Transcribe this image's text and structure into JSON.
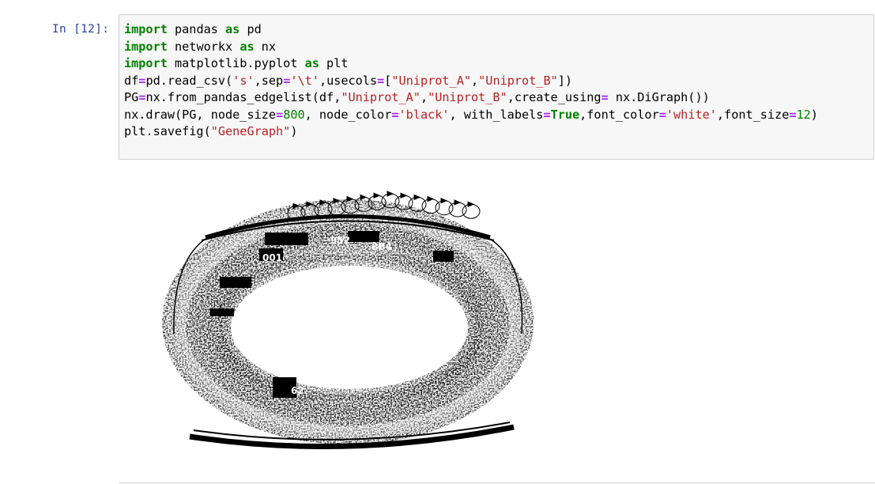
{
  "cell": {
    "prompt": "In [12]:",
    "lines": [
      [
        {
          "t": "import",
          "c": "kw"
        },
        {
          "t": " pandas ",
          "c": ""
        },
        {
          "t": "as",
          "c": "kw"
        },
        {
          "t": " pd",
          "c": ""
        }
      ],
      [
        {
          "t": "import",
          "c": "kw"
        },
        {
          "t": " networkx ",
          "c": ""
        },
        {
          "t": "as",
          "c": "kw"
        },
        {
          "t": " nx",
          "c": ""
        }
      ],
      [
        {
          "t": "import",
          "c": "kw"
        },
        {
          "t": " matplotlib.pyplot ",
          "c": ""
        },
        {
          "t": "as",
          "c": "kw"
        },
        {
          "t": " plt",
          "c": ""
        }
      ],
      [
        {
          "t": "df",
          "c": ""
        },
        {
          "t": "=",
          "c": "op"
        },
        {
          "t": "pd.read_csv(",
          "c": ""
        },
        {
          "t": "'s'",
          "c": "str"
        },
        {
          "t": ",sep",
          "c": ""
        },
        {
          "t": "=",
          "c": "op"
        },
        {
          "t": "'\\t'",
          "c": "str"
        },
        {
          "t": ",usecols",
          "c": ""
        },
        {
          "t": "=",
          "c": "op"
        },
        {
          "t": "[",
          "c": ""
        },
        {
          "t": "\"Uniprot_A\"",
          "c": "str"
        },
        {
          "t": ",",
          "c": ""
        },
        {
          "t": "\"Uniprot_B\"",
          "c": "str"
        },
        {
          "t": "])",
          "c": ""
        }
      ],
      [
        {
          "t": "PG",
          "c": ""
        },
        {
          "t": "=",
          "c": "op"
        },
        {
          "t": "nx.from_pandas_edgelist(df,",
          "c": ""
        },
        {
          "t": "\"Uniprot_A\"",
          "c": "str"
        },
        {
          "t": ",",
          "c": ""
        },
        {
          "t": "\"Uniprot_B\"",
          "c": "str"
        },
        {
          "t": ",create_using",
          "c": ""
        },
        {
          "t": "=",
          "c": "op"
        },
        {
          "t": " nx.DiGraph())",
          "c": ""
        }
      ],
      [
        {
          "t": "nx.draw(PG, node_size",
          "c": ""
        },
        {
          "t": "=",
          "c": "op"
        },
        {
          "t": "800",
          "c": "num"
        },
        {
          "t": ", node_color",
          "c": ""
        },
        {
          "t": "=",
          "c": "op"
        },
        {
          "t": "'black'",
          "c": "str"
        },
        {
          "t": ", with_labels",
          "c": ""
        },
        {
          "t": "=",
          "c": "op"
        },
        {
          "t": "True",
          "c": "kw"
        },
        {
          "t": ",font_color",
          "c": ""
        },
        {
          "t": "=",
          "c": "op"
        },
        {
          "t": "'white'",
          "c": "str"
        },
        {
          "t": ",font_size",
          "c": ""
        },
        {
          "t": "=",
          "c": "op"
        },
        {
          "t": "12",
          "c": "num"
        },
        {
          "t": ")",
          "c": ""
        }
      ],
      [
        {
          "t": "plt.savefig(",
          "c": ""
        },
        {
          "t": "\"GeneGraph\"",
          "c": "str"
        },
        {
          "t": ")",
          "c": ""
        }
      ]
    ]
  },
  "output": {
    "node_labels": [
      "952",
      "8B4",
      "001",
      "62"
    ]
  }
}
